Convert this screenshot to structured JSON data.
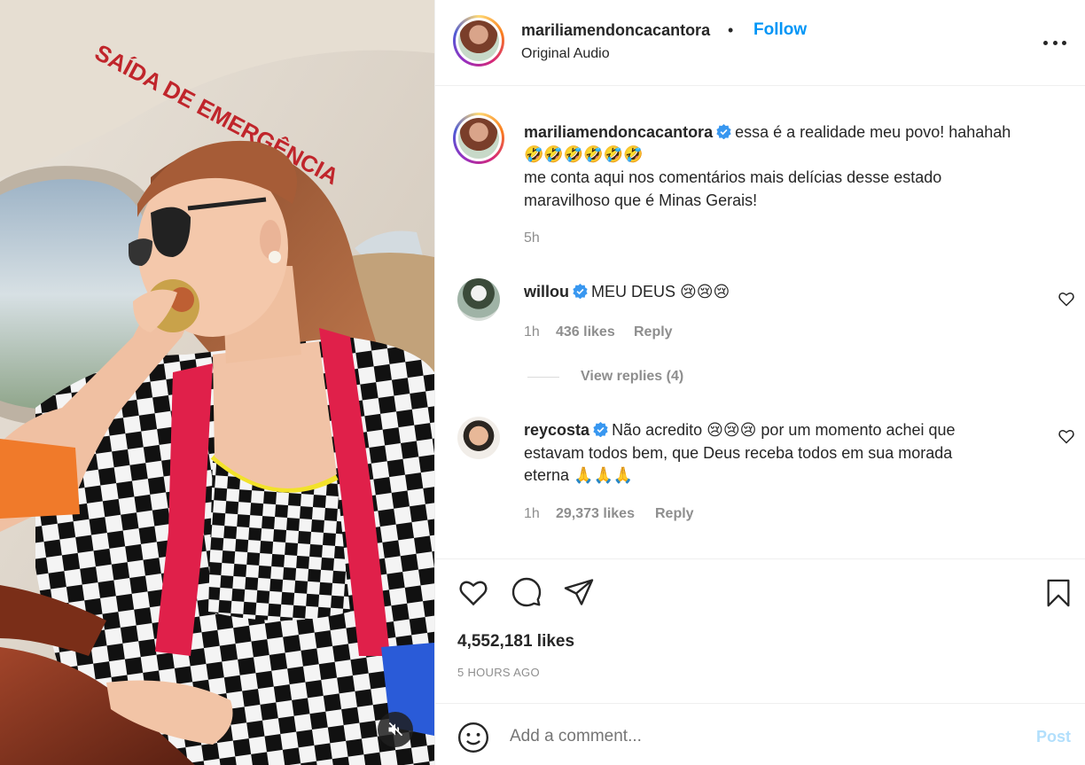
{
  "media": {
    "sign_text": "SAÍDA DE EMERGÊNCIA",
    "mute_icon": "speaker-muted-icon"
  },
  "header": {
    "username": "mariliamendoncacantora",
    "separator": "•",
    "follow_label": "Follow",
    "subtitle": "Original Audio",
    "more_icon": "more-options-icon"
  },
  "caption": {
    "username": "mariliamendoncacantora",
    "line1": "essa é a realidade meu povo! hahahah",
    "line2": "🤣🤣🤣🤣🤣🤣",
    "line3": "me conta aqui nos comentários mais delícias desse estado",
    "line4": "maravilhoso que é Minas Gerais!",
    "time": "5h"
  },
  "comments": [
    {
      "username": "willou",
      "text": "MEU DEUS 😢😢😢",
      "time": "1h",
      "likes": "436 likes",
      "reply_label": "Reply",
      "view_replies": "View replies (4)"
    },
    {
      "username": "reycosta",
      "line1": "Não acredito 😢😢😢 por um momento achei que",
      "line2": "estavam todos bem, que Deus receba todos em sua morada",
      "line3": "eterna 🙏🙏🙏",
      "time": "1h",
      "likes": "29,373 likes",
      "reply_label": "Reply"
    }
  ],
  "actions": {
    "like_icon": "heart-icon",
    "comment_icon": "comment-icon",
    "share_icon": "share-icon",
    "save_icon": "bookmark-icon",
    "likes": "4,552,181 likes",
    "time_ago": "5 HOURS AGO"
  },
  "comment_box": {
    "emoji_icon": "emoji-icon",
    "placeholder": "Add a comment...",
    "post_label": "Post"
  },
  "colors": {
    "link_blue": "#0095f6",
    "verified_blue": "#3897f0",
    "muted_text": "#8e8e8e",
    "post_disabled": "#b2dffc"
  }
}
